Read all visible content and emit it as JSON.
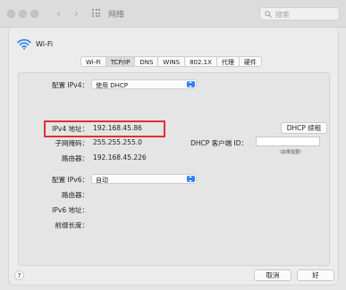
{
  "window": {
    "title": "网络",
    "search_placeholder": "搜索"
  },
  "header": {
    "label": "Wi-Fi"
  },
  "tabs": [
    "Wi-Fi",
    "TCP/IP",
    "DNS",
    "WINS",
    "802.1X",
    "代理",
    "硬件"
  ],
  "active_tab": "TCP/IP",
  "form": {
    "configure_ipv4_label": "配置 IPv4：",
    "configure_ipv4_value": "使用 DHCP",
    "ipv4_address_label": "IPv4 地址：",
    "ipv4_address_value": "192.168.45.86",
    "subnet_mask_label": "子网掩码：",
    "subnet_mask_value": "255.255.255.0",
    "router_label": "路由器：",
    "router_value": "192.168.45.226",
    "renew_dhcp_button": "DHCP 续租",
    "dhcp_client_id_label": "DHCP 客户端 ID：",
    "dhcp_client_id_value": "",
    "dhcp_client_id_hint": "（如果需要）",
    "configure_ipv6_label": "配置 IPv6：",
    "configure_ipv6_value": "自动",
    "router6_label": "路由器：",
    "ipv6_address_label": "IPv6 地址：",
    "prefix_length_label": "前缀长度："
  },
  "footer": {
    "help": "?",
    "cancel_button": "取消",
    "ok_button": "好"
  },
  "colors": {
    "accent": "#2f7ff7",
    "highlight_box": "#e03030"
  }
}
